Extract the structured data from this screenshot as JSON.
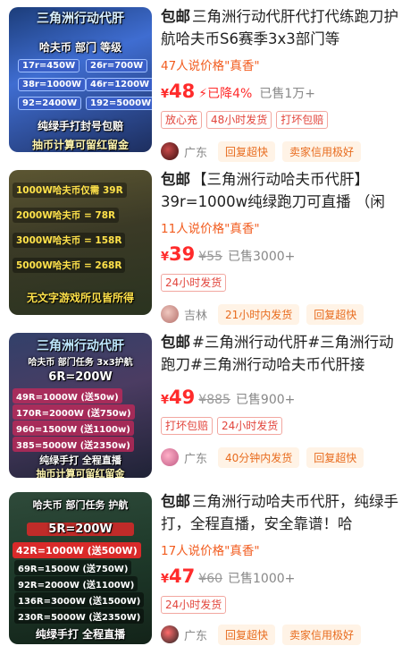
{
  "items": [
    {
      "baoyou": "包邮",
      "title": "三角洲行动代肝代打代练跑刀护航哈夫币S6赛季3x3部门等",
      "say_price": "47人说价格\"真香\"",
      "currency": "¥",
      "price": "48",
      "drop": "已降4%",
      "orig_price": "",
      "sold": "已售1万+",
      "tags": [
        "放心充",
        "48小时发货",
        "打坏包赔"
      ],
      "location": "广东",
      "pills": [
        "回复超快",
        "卖家信用极好"
      ],
      "thumb": {
        "top": "三角洲行动代肝",
        "headers": "哈夫币  部门  等级",
        "rows": [
          "17r=450W",
          "26r=700W",
          "38r=1000W",
          "46r=1200W",
          "92=2400W",
          "192=5000W"
        ],
        "banner": "纯绿手打封号包赔",
        "bottom": "抽币计算可留红留金"
      }
    },
    {
      "baoyou": "包邮",
      "title": "【三角洲行动哈夫币代肝】39r=1000w纯绿跑刀可直播 （闲",
      "say_price": "11人说价格\"真香\"",
      "currency": "¥",
      "price": "39",
      "drop": "",
      "orig_price": "¥55",
      "sold": "已售3000+",
      "tags": [
        "24小时发货"
      ],
      "location": "吉林",
      "pills": [
        "21小时内发货",
        "回复超快"
      ],
      "thumb": {
        "rows": [
          "1000W哈夫币仅需 39R",
          "2000W哈夫币 = 78R",
          "3000W哈夫币 = 158R",
          "5000W哈夫币 = 268R"
        ],
        "bottom": "无文字游戏所见皆所得"
      }
    },
    {
      "baoyou": "包邮",
      "title": "#三角洲行动代肝#三角洲行动跑刀#三角洲行动哈夫币代肝接",
      "say_price": "",
      "currency": "¥",
      "price": "49",
      "drop": "",
      "orig_price": "¥885",
      "sold": "已售900+",
      "tags": [
        "打坏包赔",
        "24小时发货"
      ],
      "location": "广东",
      "pills": [
        "40分钟内发货",
        "回复超快"
      ],
      "thumb": {
        "top": "三角洲行动代肝",
        "headers": "哈夫币  部门任务  3x3护航",
        "first": "6R=200W",
        "rows": [
          "49R=1000W (送50w)",
          "170R=2000W (送750w)",
          "960=1500W (送1100w)",
          "385=5000W (送2350w)"
        ],
        "banner": "纯绿手打 全程直播",
        "bottom": "抽币计算可留红留金"
      }
    },
    {
      "baoyou": "包邮",
      "title": "三角洲行动哈夫币代肝，纯绿手打，全程直播，安全靠谱！哈",
      "say_price": "17人说价格\"真香\"",
      "currency": "¥",
      "price": "47",
      "drop": "",
      "orig_price": "¥60",
      "sold": "已售1000+",
      "tags": [
        "24小时发货"
      ],
      "location": "广东",
      "pills": [
        "回复超快",
        "卖家信用极好"
      ],
      "thumb": {
        "headers": "哈夫币  部门任务  护航",
        "first": "5R=200W",
        "highlight": "42R=1000W (送500W)",
        "rows": [
          "69R=1500W (送750W)",
          "92R=2000W (送1100W)",
          "136R=3000W (送1500W)",
          "230R=5000W (送2350W)"
        ],
        "banner": "纯绿手打 全程直播"
      }
    }
  ],
  "colors": {
    "price_red": "#ff2b2b",
    "say_orange": "#f25c1f",
    "tag_red": "#e2453c",
    "pill_orange": "#e86c1f"
  }
}
